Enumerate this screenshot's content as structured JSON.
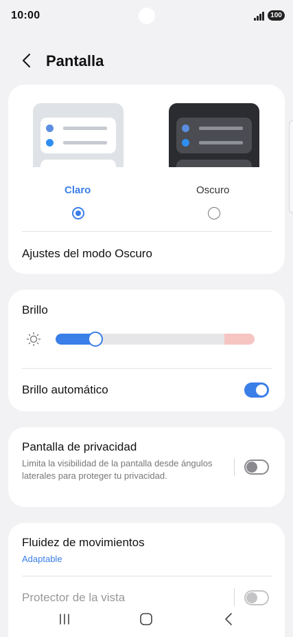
{
  "status_bar": {
    "time": "10:00",
    "battery": "100"
  },
  "header": {
    "title": "Pantalla"
  },
  "theme": {
    "light_label": "Claro",
    "dark_label": "Oscuro",
    "selected": "Claro",
    "dark_settings_label": "Ajustes del modo Oscuro",
    "colors": {
      "accent": "#3a7ee8",
      "dark_label": "#333333"
    }
  },
  "brightness": {
    "title": "Brillo",
    "level": 0.2,
    "auto_label": "Brillo automático",
    "auto_on": true
  },
  "privacy": {
    "title": "Pantalla de privacidad",
    "description": "Limita la visibilidad de la pantalla desde ángulos laterales para proteger tu privacidad.",
    "enabled": false
  },
  "motion": {
    "title": "Fluidez de movimientos",
    "value": "Adaptable",
    "eye_protector_label": "Protector de la vista",
    "eye_protector_on": false
  },
  "nav_bar": {
    "recents_icon": "recents-icon",
    "home_icon": "home-icon",
    "back_icon": "back-icon"
  }
}
